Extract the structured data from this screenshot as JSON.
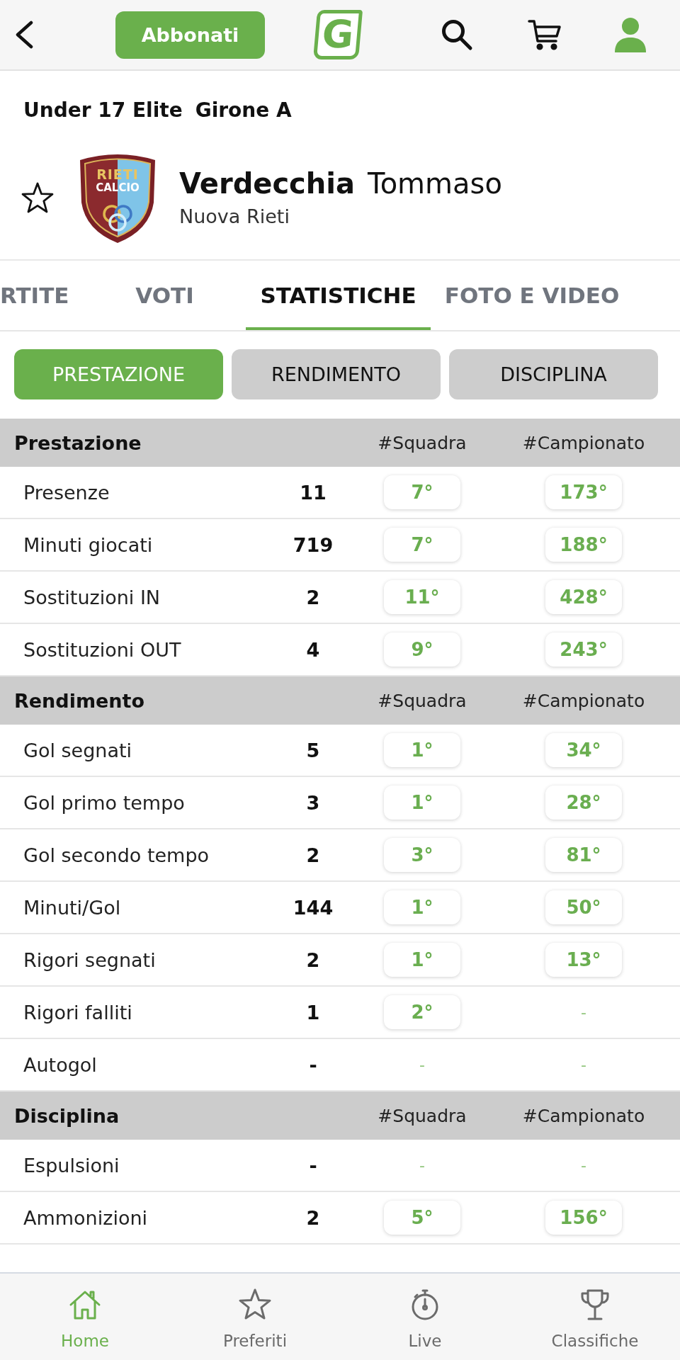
{
  "top_bar": {
    "subscribe_button": "Abbonati",
    "logo": "G"
  },
  "competition": {
    "league": "Under 17 Elite",
    "group": "Girone A"
  },
  "player": {
    "favorite": false,
    "last_name": "Verdecchia",
    "first_name": "Tommaso",
    "team": "Nuova Rieti",
    "crest": {
      "line_1": "RIETI",
      "line_2": "CALCIO"
    }
  },
  "tabs": [
    {
      "label": "RTITE",
      "selected": false
    },
    {
      "label": "VOTI",
      "selected": false
    },
    {
      "label": "STATISTICHE",
      "selected": true
    },
    {
      "label": "FOTO E VIDEO",
      "selected": false
    }
  ],
  "filters": [
    {
      "label": "PRESTAZIONE",
      "selected": true
    },
    {
      "label": "RENDIMENTO",
      "selected": false
    },
    {
      "label": "DISCIPLINA",
      "selected": false
    }
  ],
  "sections": [
    {
      "title": "Prestazione",
      "columns": [
        "#Squadra",
        "#Campionato"
      ],
      "rows": [
        {
          "label": "Presenze",
          "value": "11",
          "team_rank": {
            "text": "7°",
            "kind": "pill"
          },
          "league_rank": {
            "text": "173°",
            "kind": "pill"
          }
        },
        {
          "label": "Minuti giocati",
          "value": "719",
          "team_rank": {
            "text": "7°",
            "kind": "pill"
          },
          "league_rank": {
            "text": "188°",
            "kind": "pill"
          }
        },
        {
          "label": "Sostituzioni IN",
          "value": "2",
          "team_rank": {
            "text": "11°",
            "kind": "pill"
          },
          "league_rank": {
            "text": "428°",
            "kind": "pill"
          }
        },
        {
          "label": "Sostituzioni OUT",
          "value": "4",
          "team_rank": {
            "text": "9°",
            "kind": "pill"
          },
          "league_rank": {
            "text": "243°",
            "kind": "pill"
          }
        }
      ]
    },
    {
      "title": "Rendimento",
      "columns": [
        "#Squadra",
        "#Campionato"
      ],
      "rows": [
        {
          "label": "Gol segnati",
          "value": "5",
          "team_rank": {
            "text": "1°",
            "kind": "pill"
          },
          "league_rank": {
            "text": "34°",
            "kind": "pill"
          }
        },
        {
          "label": "Gol primo tempo",
          "value": "3",
          "team_rank": {
            "text": "1°",
            "kind": "pill"
          },
          "league_rank": {
            "text": "28°",
            "kind": "pill"
          }
        },
        {
          "label": "Gol secondo tempo",
          "value": "2",
          "team_rank": {
            "text": "3°",
            "kind": "pill"
          },
          "league_rank": {
            "text": "81°",
            "kind": "pill"
          }
        },
        {
          "label": "Minuti/Gol",
          "value": "144",
          "team_rank": {
            "text": "1°",
            "kind": "pill"
          },
          "league_rank": {
            "text": "50°",
            "kind": "pill"
          }
        },
        {
          "label": "Rigori segnati",
          "value": "2",
          "team_rank": {
            "text": "1°",
            "kind": "pill"
          },
          "league_rank": {
            "text": "13°",
            "kind": "pill"
          }
        },
        {
          "label": "Rigori falliti",
          "value": "1",
          "team_rank": {
            "text": "2°",
            "kind": "pill"
          },
          "league_rank": {
            "text": "-",
            "kind": "plain"
          }
        },
        {
          "label": "Autogol",
          "value": "-",
          "team_rank": {
            "text": "-",
            "kind": "plain"
          },
          "league_rank": {
            "text": "-",
            "kind": "plain"
          }
        }
      ]
    },
    {
      "title": "Disciplina",
      "columns": [
        "#Squadra",
        "#Campionato"
      ],
      "rows": [
        {
          "label": "Espulsioni",
          "value": "-",
          "team_rank": {
            "text": "-",
            "kind": "plain"
          },
          "league_rank": {
            "text": "-",
            "kind": "plain"
          }
        },
        {
          "label": "Ammonizioni",
          "value": "2",
          "team_rank": {
            "text": "5°",
            "kind": "pill"
          },
          "league_rank": {
            "text": "156°",
            "kind": "pill"
          }
        }
      ]
    }
  ],
  "bottom_nav": [
    {
      "label": "Home",
      "kind": "home",
      "selected": true
    },
    {
      "label": "Preferiti",
      "kind": "star",
      "selected": false
    },
    {
      "label": "Live",
      "kind": "stopwatch",
      "selected": false
    },
    {
      "label": "Classifiche",
      "kind": "trophy",
      "selected": false
    }
  ]
}
